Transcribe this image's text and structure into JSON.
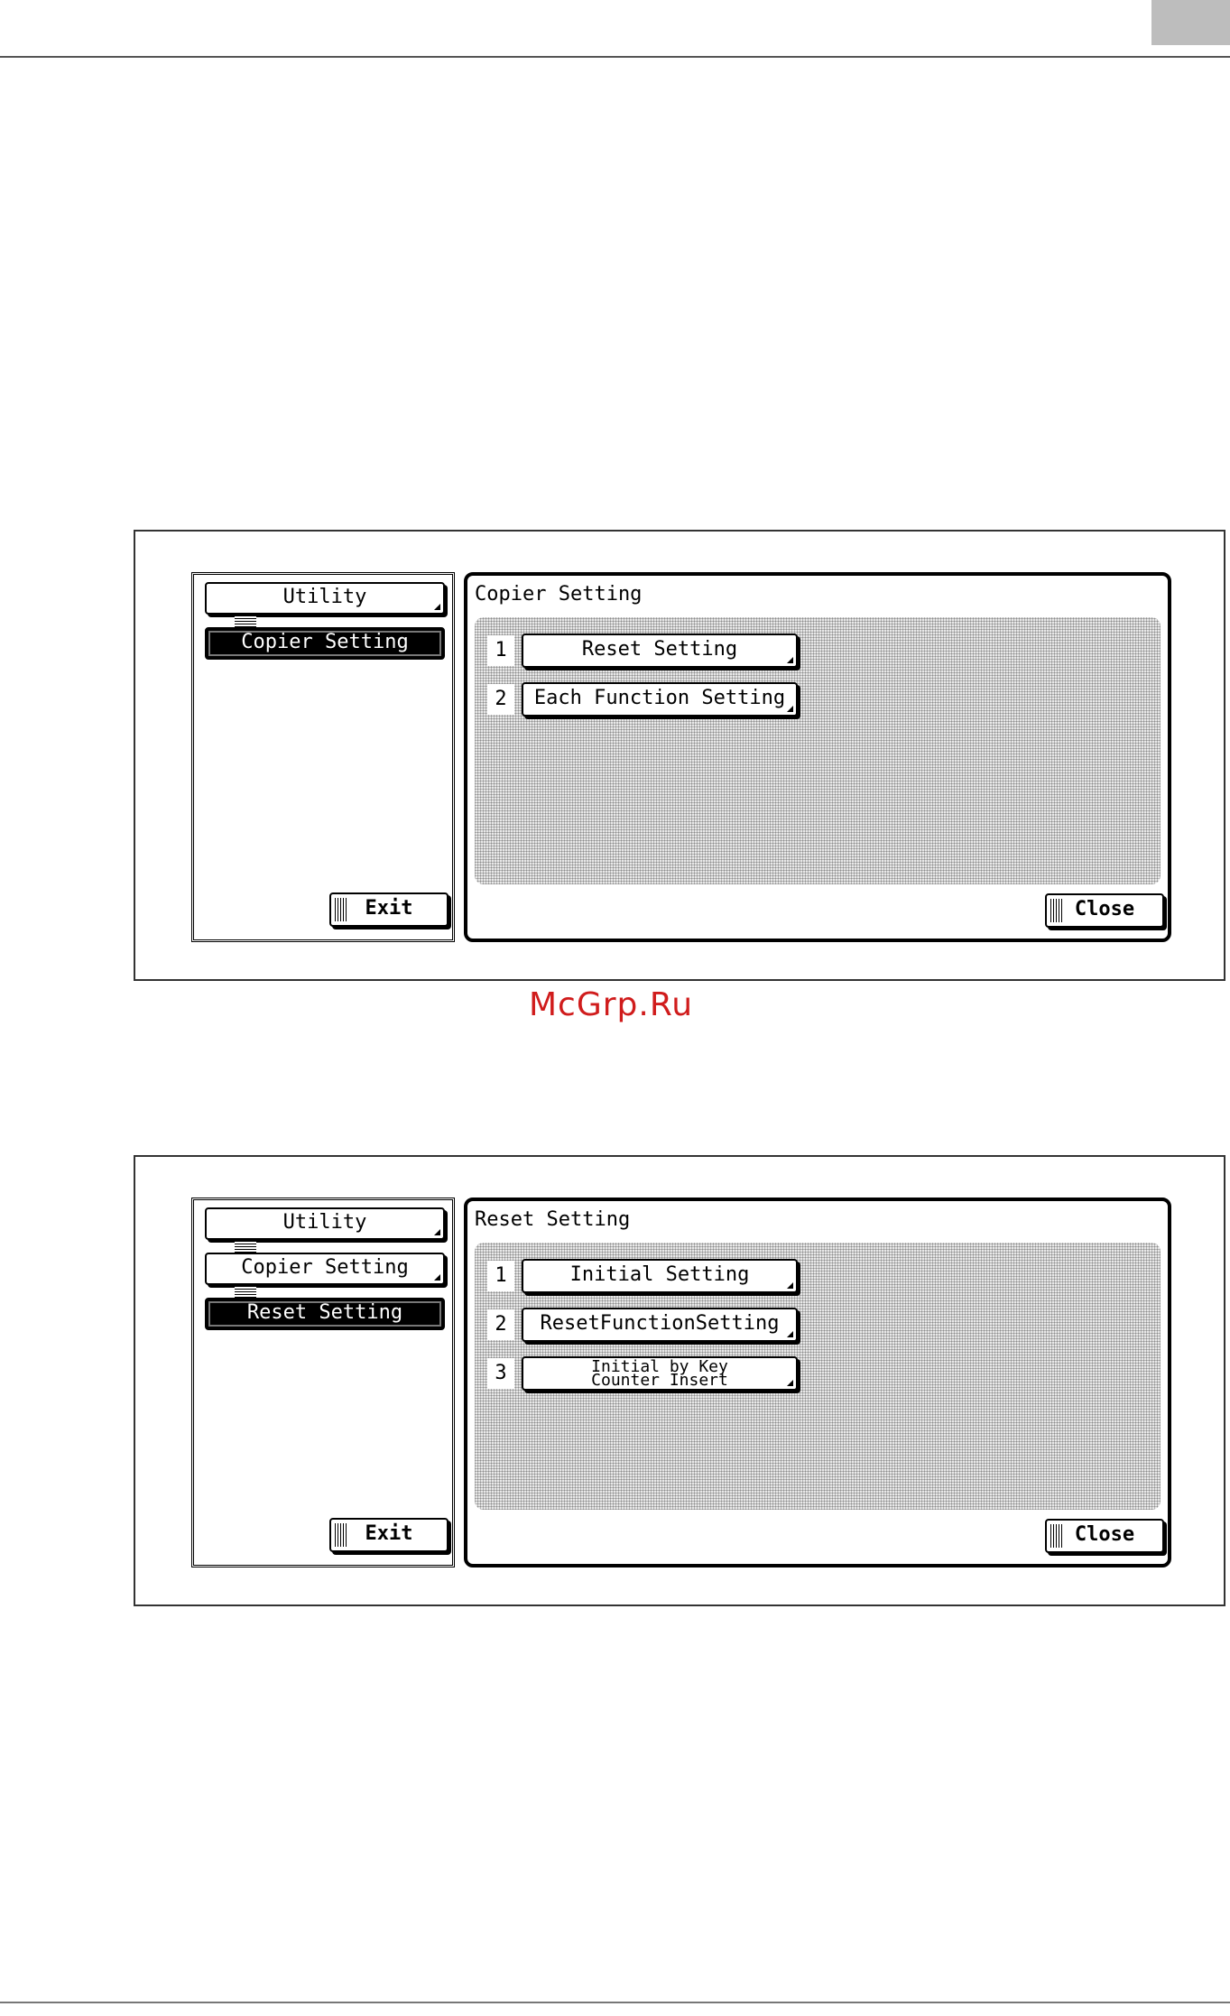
{
  "watermark": "McGrp.Ru",
  "screens": [
    {
      "nav": [
        "Utility",
        "Copier Setting"
      ],
      "active_index": 1,
      "title": "Copier Setting",
      "items": [
        {
          "num": "1",
          "label": "Reset Setting"
        },
        {
          "num": "2",
          "label": "Each Function Setting"
        }
      ],
      "exit_label": "Exit",
      "close_label": "Close"
    },
    {
      "nav": [
        "Utility",
        "Copier Setting",
        "Reset Setting"
      ],
      "active_index": 2,
      "title": "Reset Setting",
      "items": [
        {
          "num": "1",
          "label": "Initial Setting"
        },
        {
          "num": "2",
          "label": "ResetFunctionSetting"
        },
        {
          "num": "3",
          "label_line1": "Initial by Key",
          "label_line2": "Counter Insert"
        }
      ],
      "exit_label": "Exit",
      "close_label": "Close"
    }
  ]
}
